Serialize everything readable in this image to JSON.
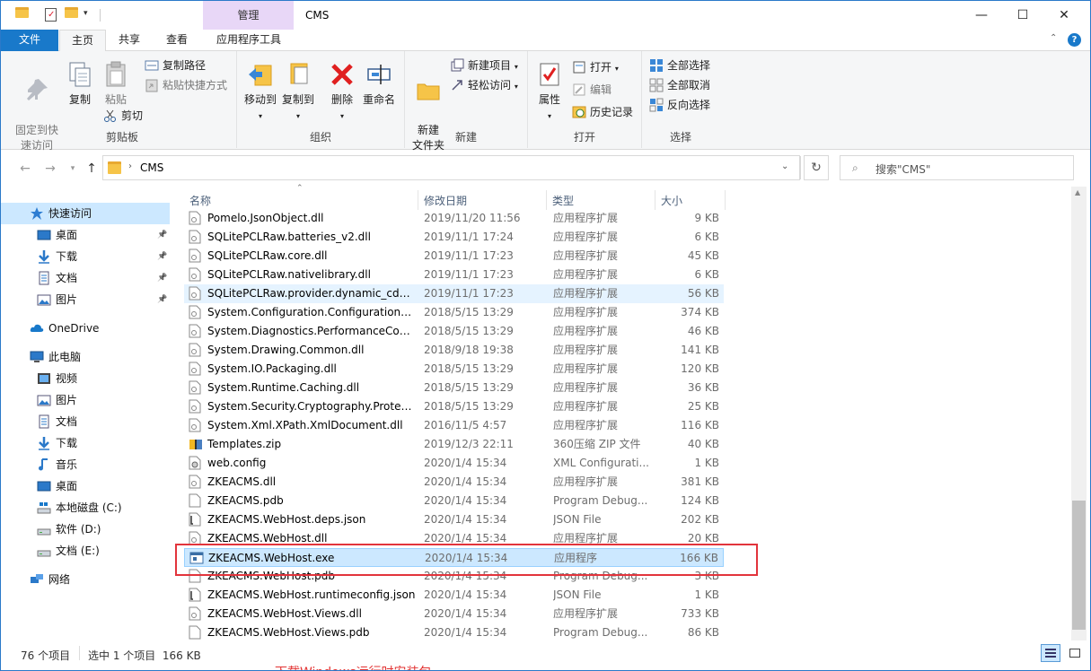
{
  "window": {
    "title": "CMS",
    "context_tab": "管理",
    "controls": {
      "minimize": "—",
      "maximize": "☐",
      "close": "✕"
    }
  },
  "tabs": {
    "file": "文件",
    "home": "主页",
    "share": "共享",
    "view": "查看",
    "app_tools": "应用程序工具"
  },
  "ribbon": {
    "clipboard": {
      "label": "剪贴板",
      "pin_quick": "固定到快速访问",
      "copy": "复制",
      "paste": "粘贴",
      "copy_path": "复制路径",
      "paste_shortcut": "粘贴快捷方式",
      "cut": "剪切"
    },
    "organize": {
      "label": "组织",
      "move_to": "移动到",
      "copy_to": "复制到",
      "delete": "删除",
      "rename": "重命名"
    },
    "new": {
      "label": "新建",
      "new_folder": "新建\n文件夹",
      "new_item": "新建项目",
      "easy_access": "轻松访问"
    },
    "open": {
      "label": "打开",
      "properties": "属性",
      "open": "打开",
      "edit": "编辑",
      "history": "历史记录"
    },
    "select": {
      "label": "选择",
      "select_all": "全部选择",
      "select_none": "全部取消",
      "invert": "反向选择"
    }
  },
  "address": {
    "path": "CMS",
    "search_placeholder": "搜索\"CMS\""
  },
  "sidebar": {
    "quick_access": "快速访问",
    "qa_items": [
      "桌面",
      "下载",
      "文档",
      "图片"
    ],
    "onedrive": "OneDrive",
    "this_pc": "此电脑",
    "pc_items": [
      "视频",
      "图片",
      "文档",
      "下载",
      "音乐",
      "桌面",
      "本地磁盘 (C:)",
      "软件 (D:)",
      "文档 (E:)"
    ],
    "network": "网络"
  },
  "columns": {
    "name": "名称",
    "date": "修改日期",
    "type": "类型",
    "size": "大小"
  },
  "files": [
    {
      "name": "Pomelo.JsonObject.dll",
      "date": "2019/11/20 11:56",
      "type": "应用程序扩展",
      "size": "9 KB",
      "icon": "dll"
    },
    {
      "name": "SQLitePCLRaw.batteries_v2.dll",
      "date": "2019/11/1 17:24",
      "type": "应用程序扩展",
      "size": "6 KB",
      "icon": "dll"
    },
    {
      "name": "SQLitePCLRaw.core.dll",
      "date": "2019/11/1 17:23",
      "type": "应用程序扩展",
      "size": "45 KB",
      "icon": "dll"
    },
    {
      "name": "SQLitePCLRaw.nativelibrary.dll",
      "date": "2019/11/1 17:23",
      "type": "应用程序扩展",
      "size": "6 KB",
      "icon": "dll"
    },
    {
      "name": "SQLitePCLRaw.provider.dynamic_cde...",
      "date": "2019/11/1 17:23",
      "type": "应用程序扩展",
      "size": "56 KB",
      "icon": "dll"
    },
    {
      "name": "System.Configuration.ConfigurationM...",
      "date": "2018/5/15 13:29",
      "type": "应用程序扩展",
      "size": "374 KB",
      "icon": "dll"
    },
    {
      "name": "System.Diagnostics.PerformanceCou...",
      "date": "2018/5/15 13:29",
      "type": "应用程序扩展",
      "size": "46 KB",
      "icon": "dll"
    },
    {
      "name": "System.Drawing.Common.dll",
      "date": "2018/9/18 19:38",
      "type": "应用程序扩展",
      "size": "141 KB",
      "icon": "dll"
    },
    {
      "name": "System.IO.Packaging.dll",
      "date": "2018/5/15 13:29",
      "type": "应用程序扩展",
      "size": "120 KB",
      "icon": "dll"
    },
    {
      "name": "System.Runtime.Caching.dll",
      "date": "2018/5/15 13:29",
      "type": "应用程序扩展",
      "size": "36 KB",
      "icon": "dll"
    },
    {
      "name": "System.Security.Cryptography.Protect...",
      "date": "2018/5/15 13:29",
      "type": "应用程序扩展",
      "size": "25 KB",
      "icon": "dll"
    },
    {
      "name": "System.Xml.XPath.XmlDocument.dll",
      "date": "2016/11/5 4:57",
      "type": "应用程序扩展",
      "size": "116 KB",
      "icon": "dll"
    },
    {
      "name": "Templates.zip",
      "date": "2019/12/3 22:11",
      "type": "360压缩 ZIP 文件",
      "size": "40 KB",
      "icon": "zip"
    },
    {
      "name": "web.config",
      "date": "2020/1/4 15:34",
      "type": "XML Configurati...",
      "size": "1 KB",
      "icon": "config"
    },
    {
      "name": "ZKEACMS.dll",
      "date": "2020/1/4 15:34",
      "type": "应用程序扩展",
      "size": "381 KB",
      "icon": "dll"
    },
    {
      "name": "ZKEACMS.pdb",
      "date": "2020/1/4 15:34",
      "type": "Program Debug...",
      "size": "124 KB",
      "icon": "file"
    },
    {
      "name": "ZKEACMS.WebHost.deps.json",
      "date": "2020/1/4 15:34",
      "type": "JSON File",
      "size": "202 KB",
      "icon": "json"
    },
    {
      "name": "ZKEACMS.WebHost.dll",
      "date": "2020/1/4 15:34",
      "type": "应用程序扩展",
      "size": "20 KB",
      "icon": "dll"
    },
    {
      "name": "ZKEACMS.WebHost.exe",
      "date": "2020/1/4 15:34",
      "type": "应用程序",
      "size": "166 KB",
      "icon": "exe"
    },
    {
      "name": "ZKEACMS.WebHost.pdb",
      "date": "2020/1/4 15:34",
      "type": "Program Debug...",
      "size": "3 KB",
      "icon": "file"
    },
    {
      "name": "ZKEACMS.WebHost.runtimeconfig.json",
      "date": "2020/1/4 15:34",
      "type": "JSON File",
      "size": "1 KB",
      "icon": "json"
    },
    {
      "name": "ZKEACMS.WebHost.Views.dll",
      "date": "2020/1/4 15:34",
      "type": "应用程序扩展",
      "size": "733 KB",
      "icon": "dll"
    },
    {
      "name": "ZKEACMS.WebHost.Views.pdb",
      "date": "2020/1/4 15:34",
      "type": "Program Debug...",
      "size": "86 KB",
      "icon": "file"
    }
  ],
  "status": {
    "count": "76 个项目",
    "selection": "选中 1 个项目  166 KB"
  },
  "overlay_text": "下载Windows运行时安装包",
  "colors": {
    "accent": "#1979ca",
    "selection": "#cce8ff",
    "highlight_box": "#e2343c",
    "context_tab": "#e8d7f7"
  }
}
